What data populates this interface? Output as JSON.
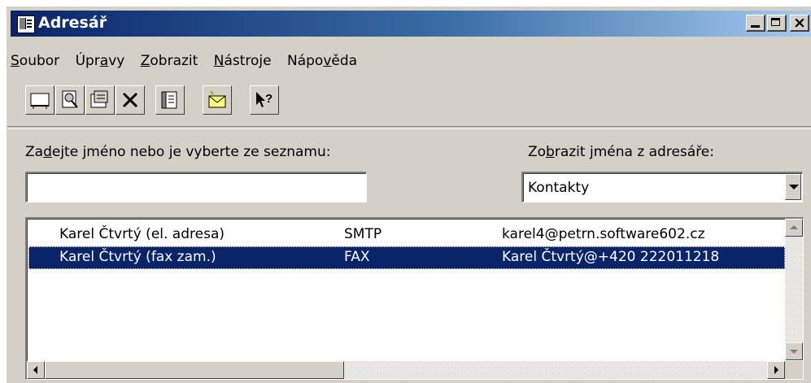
{
  "window": {
    "title": "Adresář",
    "icon": "address-book-icon"
  },
  "menu": {
    "items": [
      {
        "label_pre": "",
        "label_ul": "S",
        "label_post": "oubor"
      },
      {
        "label_pre": "Úpr",
        "label_ul": "a",
        "label_post": "vy"
      },
      {
        "label_pre": "",
        "label_ul": "Z",
        "label_post": "obrazit"
      },
      {
        "label_pre": "",
        "label_ul": "N",
        "label_post": "ástroje"
      },
      {
        "label_pre": "Nápo",
        "label_ul": "v",
        "label_post": "ěda"
      }
    ]
  },
  "toolbar": {
    "buttons": [
      "new-entry-icon",
      "properties-find-icon",
      "properties-icon",
      "delete-icon",
      "address-book-icon",
      "new-message-icon",
      "whats-this-help-icon"
    ]
  },
  "search": {
    "label_pre": "Za",
    "label_ul": "d",
    "label_post": "ejte jméno nebo je vyberte ze seznamu:",
    "value": ""
  },
  "source": {
    "label_pre": "Zo",
    "label_ul": "b",
    "label_post": "razit jména z adresáře:",
    "selected": "Kontakty"
  },
  "list": {
    "rows": [
      {
        "name": "Karel Čtvrtý (el. adresa)",
        "type": "SMTP",
        "address": "karel4@petrn.software602.cz",
        "selected": false
      },
      {
        "name": "Karel Čtvrtý (fax zam.)",
        "type": "FAX",
        "address": "Karel Čtvrtý@+420 222011218",
        "selected": true
      }
    ]
  },
  "colors": {
    "selection": "#0a246a",
    "face": "#d4d0c8"
  }
}
